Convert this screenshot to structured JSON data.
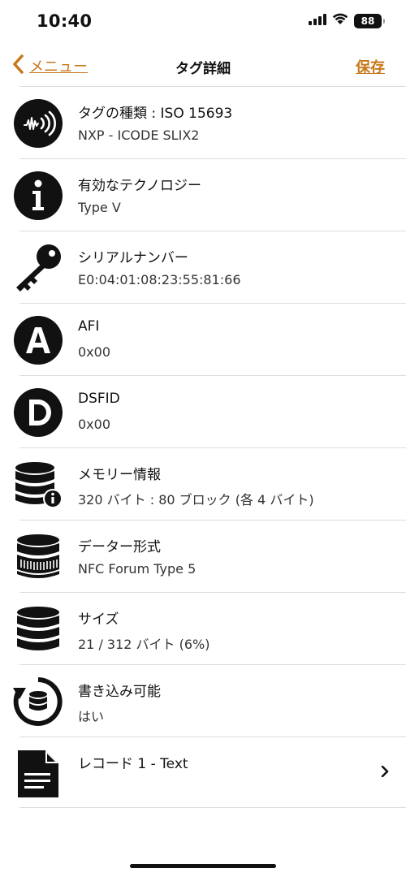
{
  "status": {
    "time": "10:40",
    "battery": "88"
  },
  "nav": {
    "back_label": "メニュー",
    "title": "タグ詳細",
    "save_label": "保存"
  },
  "rows": [
    {
      "title": "タグの種類 : ISO 15693",
      "subtitle": "NXP - ICODE SLIX2",
      "icon": "nfc-wave-icon"
    },
    {
      "title": "有効なテクノロジー",
      "subtitle": "Type V",
      "icon": "info-icon"
    },
    {
      "title": "シリアルナンバー",
      "subtitle": "E0:04:01:08:23:55:81:66",
      "icon": "key-icon"
    },
    {
      "title": "AFI",
      "subtitle": "0x00",
      "icon": "letter-a-icon"
    },
    {
      "title": "DSFID",
      "subtitle": "0x00",
      "icon": "letter-d-icon"
    },
    {
      "title": "メモリー情報",
      "subtitle": "320 バイト : 80 ブロック (各 4 バイト)",
      "icon": "database-info-icon"
    },
    {
      "title": "データー形式",
      "subtitle": "NFC Forum Type 5",
      "icon": "database-format-icon"
    },
    {
      "title": "サイズ",
      "subtitle": "21 / 312 バイト (6%)",
      "icon": "database-icon"
    },
    {
      "title": "書き込み可能",
      "subtitle": "はい",
      "icon": "database-refresh-icon"
    },
    {
      "title": "レコード 1 - Text",
      "icon": "document-icon"
    }
  ]
}
